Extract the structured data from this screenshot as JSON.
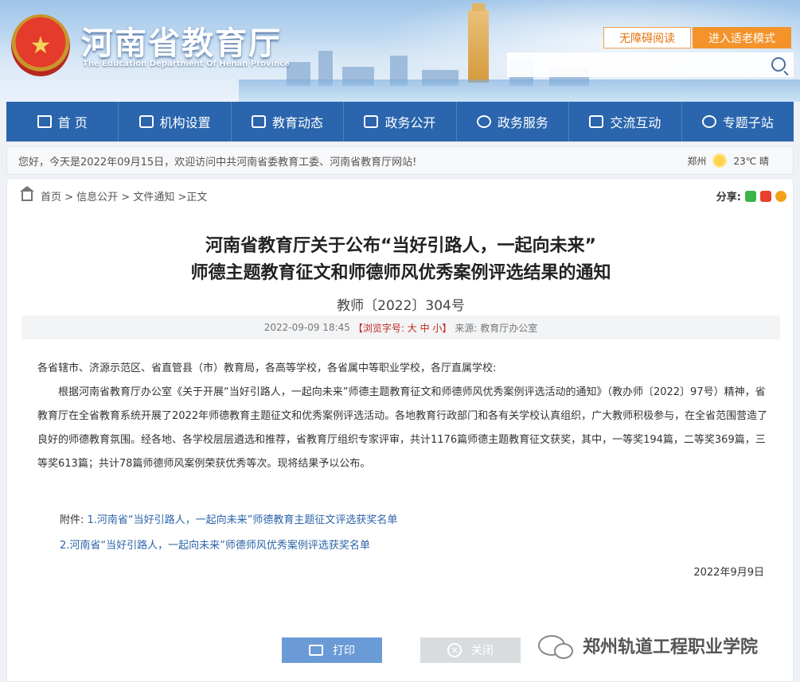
{
  "header": {
    "site_title": "河南省教育厅",
    "site_subtitle": "The Education Department Of Henan Province",
    "accessibility_label": "无障碍阅读",
    "elder_mode_label": "进入适老模式",
    "search_placeholder": ""
  },
  "nav": {
    "items": [
      {
        "label": "首 页",
        "icon": "home-icon"
      },
      {
        "label": "机构设置",
        "icon": "org-icon"
      },
      {
        "label": "教育动态",
        "icon": "news-icon"
      },
      {
        "label": "政务公开",
        "icon": "doc-icon"
      },
      {
        "label": "政务服务",
        "icon": "service-icon"
      },
      {
        "label": "交流互动",
        "icon": "chat-icon"
      },
      {
        "label": "专题子站",
        "icon": "topic-icon"
      }
    ]
  },
  "infobar": {
    "greeting": "您好，今天是2022年09月15日，欢迎访问中共河南省委教育工委、河南省教育厅网站!",
    "city": "郑州",
    "temperature": "23℃ 晴"
  },
  "breadcrumb": {
    "text": "首页 > 信息公开 > 文件通知 >正文"
  },
  "share": {
    "label": "分享:"
  },
  "article": {
    "title_line1": "河南省教育厅关于公布“当好引路人，一起向未来”",
    "title_line2": "师德主题教育征文和师德师风优秀案例评选结果的通知",
    "doc_number": "教师〔2022〕304号",
    "meta_date": "2022-09-09 18:45",
    "meta_font": "【浏览字号: 大 中 小】",
    "meta_source": "来源: 教育厅办公室",
    "salutation": "各省辖市、济源示范区、省直管县（市）教育局，各高等学校，各省属中等职业学校，各厅直属学校:",
    "paragraph": "根据河南省教育厅办公室《关于开展“当好引路人，一起向未来”师德主题教育征文和师德师风优秀案例评选活动的通知》（教办师〔2022〕97号）精神，省教育厅在全省教育系统开展了2022年师德教育主题征文和优秀案例评选活动。各地教育行政部门和各有关学校认真组织，广大教师积极参与，在全省范围营造了良好的师德教育氛围。经各地、各学校层层遴选和推荐，省教育厅组织专家评审，共计1176篇师德主题教育征文获奖，其中，一等奖194篇，二等奖369篇，三等奖613篇；共计78篇师德师风案例荣获优秀等次。现将结果予以公布。",
    "attach_label": "附件: ",
    "attach1": "1.河南省“当好引路人，一起向未来”师德教育主题征文评选获奖名单",
    "attach2": "2.河南省“当好引路人，一起向未来”师德师风优秀案例评选获奖名单",
    "sign_date": "2022年9月9日"
  },
  "actions": {
    "print_label": "打印",
    "close_label": "关闭"
  },
  "watermark": {
    "text": "郑州轨道工程职业学院"
  }
}
